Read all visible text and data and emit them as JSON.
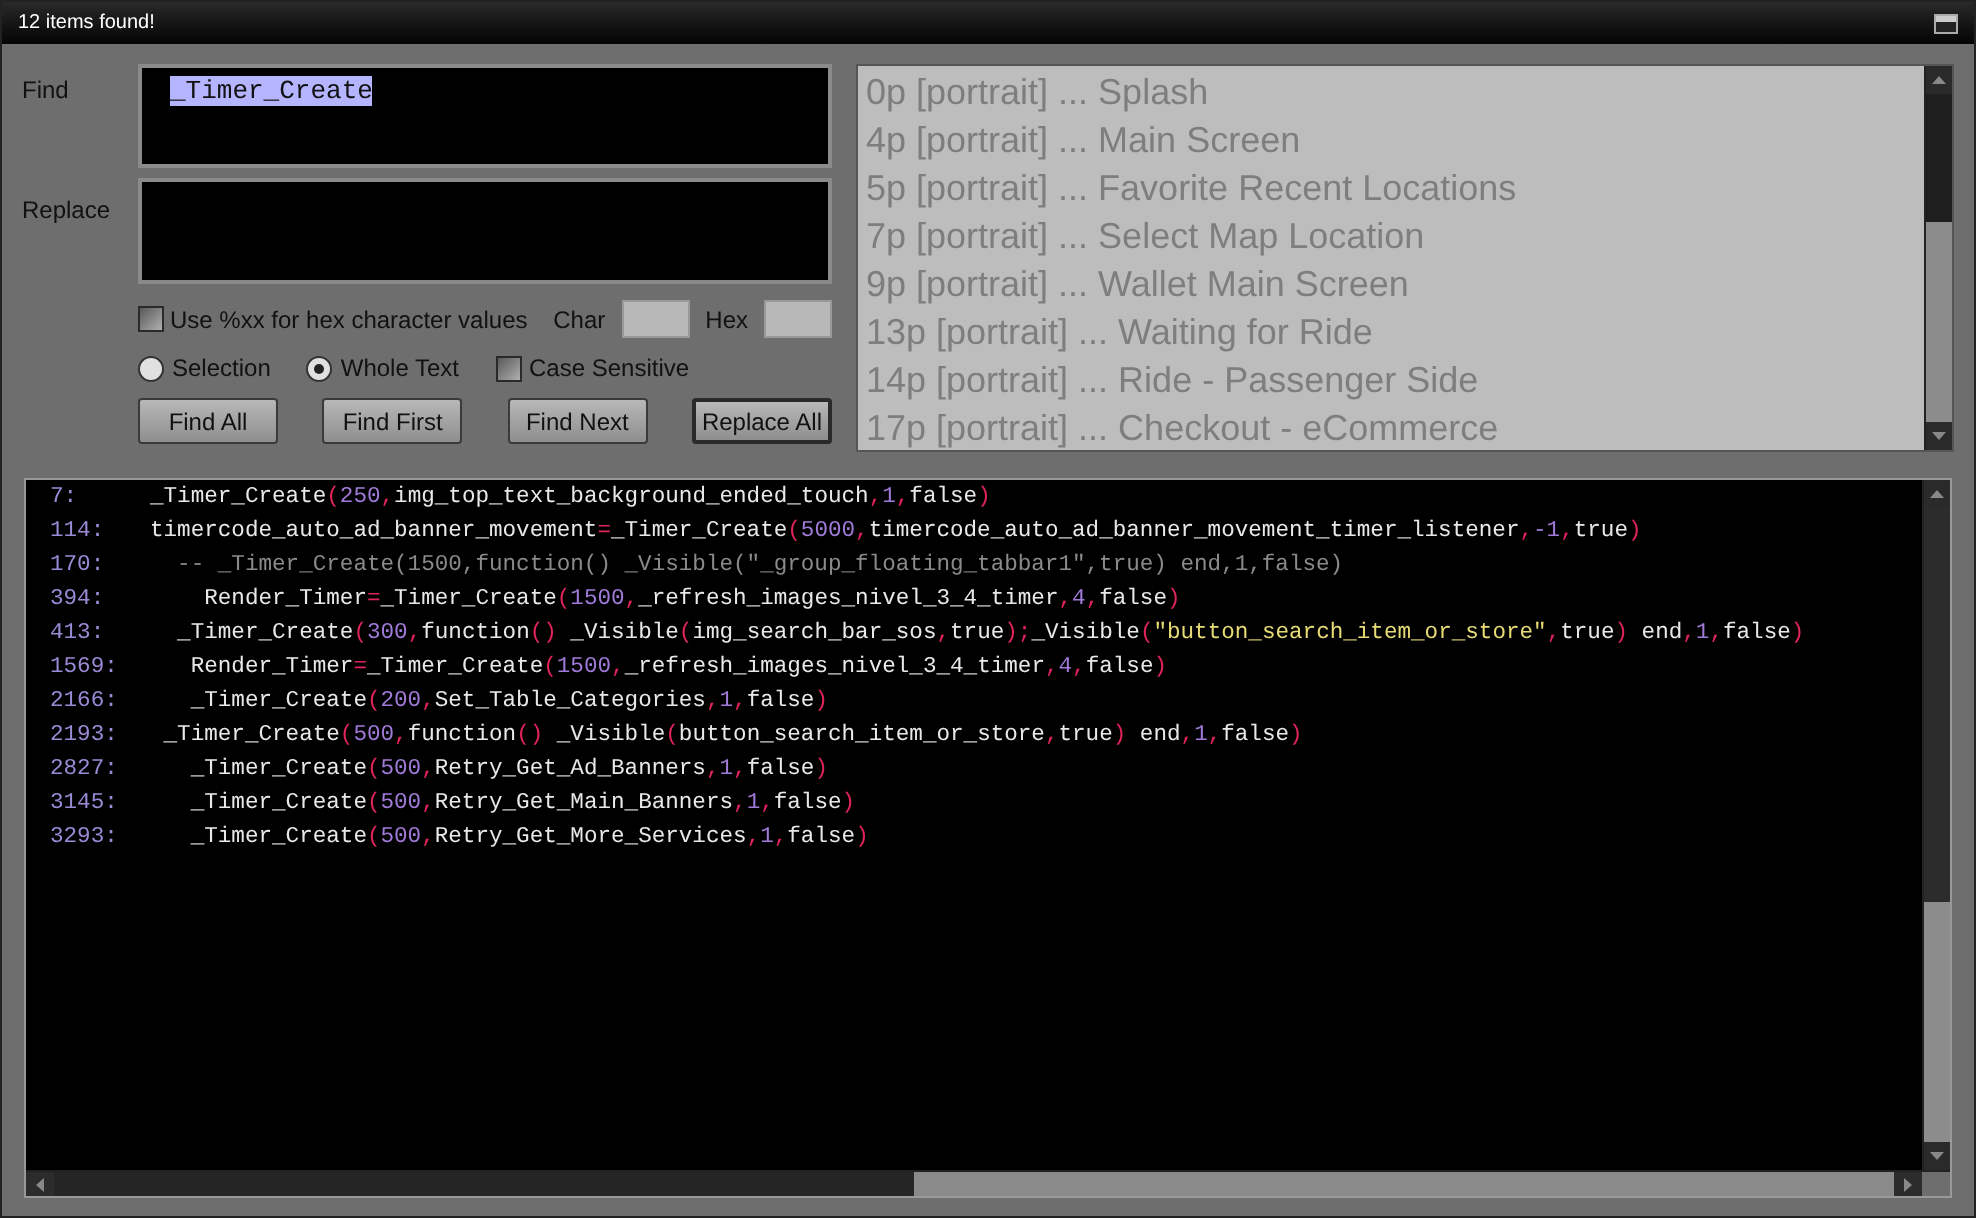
{
  "window": {
    "title": "12 items found!"
  },
  "find": {
    "label": "Find",
    "value": "_Timer_Create",
    "value_selected": true
  },
  "replace": {
    "label": "Replace"
  },
  "hex_option": {
    "label": "Use %xx for hex character values",
    "checked": false
  },
  "char_label": "Char",
  "hex_label": "Hex",
  "scope": [
    {
      "label": "Selection",
      "selected": false
    },
    {
      "label": "Whole Text",
      "selected": true
    }
  ],
  "case_sensitive": {
    "label": "Case Sensitive",
    "checked": false
  },
  "buttons": [
    "Find All",
    "Find First",
    "Find Next",
    "Replace All"
  ],
  "screens": [
    "0p [portrait] ... Splash",
    "4p [portrait] ... Main Screen",
    "5p [portrait] ... Favorite Recent Locations",
    "7p [portrait] ... Select Map Location",
    "9p [portrait] ... Wallet Main Screen",
    "13p [portrait] ... Waiting for Ride",
    "14p [portrait] ... Ride - Passenger Side",
    "17p [portrait] ... Checkout - eCommerce"
  ],
  "results": [
    {
      "line": "7:",
      "code": [
        {
          "kind": "t",
          "text": "_Timer_Create"
        },
        {
          "kind": "p",
          "text": "("
        },
        {
          "kind": "n",
          "text": "250"
        },
        {
          "kind": "p",
          "text": ","
        },
        {
          "kind": "t",
          "text": "img_top_text_background_ended_touch"
        },
        {
          "kind": "p",
          "text": ","
        },
        {
          "kind": "n",
          "text": "1"
        },
        {
          "kind": "p",
          "text": ","
        },
        {
          "kind": "t",
          "text": "false"
        },
        {
          "kind": "p",
          "text": ")"
        }
      ]
    },
    {
      "line": "114:",
      "code": [
        {
          "kind": "t",
          "text": "timercode_auto_ad_banner_movement"
        },
        {
          "kind": "p",
          "text": "="
        },
        {
          "kind": "t",
          "text": "_Timer_Create"
        },
        {
          "kind": "p",
          "text": "("
        },
        {
          "kind": "n",
          "text": "5000"
        },
        {
          "kind": "p",
          "text": ","
        },
        {
          "kind": "t",
          "text": "timercode_auto_ad_banner_movement_timer_listener"
        },
        {
          "kind": "p",
          "text": ","
        },
        {
          "kind": "n",
          "text": "-1"
        },
        {
          "kind": "p",
          "text": ","
        },
        {
          "kind": "t",
          "text": "true"
        },
        {
          "kind": "p",
          "text": ")"
        }
      ]
    },
    {
      "line": "170:",
      "code": [
        {
          "kind": "c",
          "text": "  -- _Timer_Create(1500,function() _Visible(\"_group_floating_tabbar1\",true) end,1,false)"
        }
      ]
    },
    {
      "line": "394:",
      "code": [
        {
          "kind": "t",
          "text": "    Render_Timer"
        },
        {
          "kind": "p",
          "text": "="
        },
        {
          "kind": "t",
          "text": "_Timer_Create"
        },
        {
          "kind": "p",
          "text": "("
        },
        {
          "kind": "n",
          "text": "1500"
        },
        {
          "kind": "p",
          "text": ","
        },
        {
          "kind": "t",
          "text": "_refresh_images_nivel_3_4_timer"
        },
        {
          "kind": "p",
          "text": ","
        },
        {
          "kind": "n",
          "text": "4"
        },
        {
          "kind": "p",
          "text": ","
        },
        {
          "kind": "t",
          "text": "false"
        },
        {
          "kind": "p",
          "text": ")"
        }
      ]
    },
    {
      "line": "413:",
      "code": [
        {
          "kind": "t",
          "text": "  _Timer_Create"
        },
        {
          "kind": "p",
          "text": "("
        },
        {
          "kind": "n",
          "text": "300"
        },
        {
          "kind": "p",
          "text": ","
        },
        {
          "kind": "t",
          "text": "function"
        },
        {
          "kind": "p",
          "text": "()"
        },
        {
          "kind": "t",
          "text": " _Visible"
        },
        {
          "kind": "p",
          "text": "("
        },
        {
          "kind": "t",
          "text": "img_search_bar_sos"
        },
        {
          "kind": "p",
          "text": ","
        },
        {
          "kind": "t",
          "text": "true"
        },
        {
          "kind": "p",
          "text": ");"
        },
        {
          "kind": "t",
          "text": "_Visible"
        },
        {
          "kind": "p",
          "text": "("
        },
        {
          "kind": "s",
          "text": "\"button_search_item_or_store\""
        },
        {
          "kind": "p",
          "text": ","
        },
        {
          "kind": "t",
          "text": "true"
        },
        {
          "kind": "p",
          "text": ")"
        },
        {
          "kind": "t",
          "text": " end"
        },
        {
          "kind": "p",
          "text": ","
        },
        {
          "kind": "n",
          "text": "1"
        },
        {
          "kind": "p",
          "text": ","
        },
        {
          "kind": "t",
          "text": "false"
        },
        {
          "kind": "p",
          "text": ")"
        }
      ]
    },
    {
      "line": "1569:",
      "code": [
        {
          "kind": "t",
          "text": "   Render_Timer"
        },
        {
          "kind": "p",
          "text": "="
        },
        {
          "kind": "t",
          "text": "_Timer_Create"
        },
        {
          "kind": "p",
          "text": "("
        },
        {
          "kind": "n",
          "text": "1500"
        },
        {
          "kind": "p",
          "text": ","
        },
        {
          "kind": "t",
          "text": "_refresh_images_nivel_3_4_timer"
        },
        {
          "kind": "p",
          "text": ","
        },
        {
          "kind": "n",
          "text": "4"
        },
        {
          "kind": "p",
          "text": ","
        },
        {
          "kind": "t",
          "text": "false"
        },
        {
          "kind": "p",
          "text": ")"
        }
      ]
    },
    {
      "line": "2166:",
      "code": [
        {
          "kind": "t",
          "text": "   _Timer_Create"
        },
        {
          "kind": "p",
          "text": "("
        },
        {
          "kind": "n",
          "text": "200"
        },
        {
          "kind": "p",
          "text": ","
        },
        {
          "kind": "t",
          "text": "Set_Table_Categories"
        },
        {
          "kind": "p",
          "text": ","
        },
        {
          "kind": "n",
          "text": "1"
        },
        {
          "kind": "p",
          "text": ","
        },
        {
          "kind": "t",
          "text": "false"
        },
        {
          "kind": "p",
          "text": ")"
        }
      ]
    },
    {
      "line": "2193:",
      "code": [
        {
          "kind": "t",
          "text": " _Timer_Create"
        },
        {
          "kind": "p",
          "text": "("
        },
        {
          "kind": "n",
          "text": "500"
        },
        {
          "kind": "p",
          "text": ","
        },
        {
          "kind": "t",
          "text": "function"
        },
        {
          "kind": "p",
          "text": "()"
        },
        {
          "kind": "t",
          "text": " _Visible"
        },
        {
          "kind": "p",
          "text": "("
        },
        {
          "kind": "t",
          "text": "button_search_item_or_store"
        },
        {
          "kind": "p",
          "text": ","
        },
        {
          "kind": "t",
          "text": "true"
        },
        {
          "kind": "p",
          "text": ")"
        },
        {
          "kind": "t",
          "text": " end"
        },
        {
          "kind": "p",
          "text": ","
        },
        {
          "kind": "n",
          "text": "1"
        },
        {
          "kind": "p",
          "text": ","
        },
        {
          "kind": "t",
          "text": "false"
        },
        {
          "kind": "p",
          "text": ")"
        }
      ]
    },
    {
      "line": "2827:",
      "code": [
        {
          "kind": "t",
          "text": "   _Timer_Create"
        },
        {
          "kind": "p",
          "text": "("
        },
        {
          "kind": "n",
          "text": "500"
        },
        {
          "kind": "p",
          "text": ","
        },
        {
          "kind": "t",
          "text": "Retry_Get_Ad_Banners"
        },
        {
          "kind": "p",
          "text": ","
        },
        {
          "kind": "n",
          "text": "1"
        },
        {
          "kind": "p",
          "text": ","
        },
        {
          "kind": "t",
          "text": "false"
        },
        {
          "kind": "p",
          "text": ")"
        }
      ]
    },
    {
      "line": "3145:",
      "code": [
        {
          "kind": "t",
          "text": "   _Timer_Create"
        },
        {
          "kind": "p",
          "text": "("
        },
        {
          "kind": "n",
          "text": "500"
        },
        {
          "kind": "p",
          "text": ","
        },
        {
          "kind": "t",
          "text": "Retry_Get_Main_Banners"
        },
        {
          "kind": "p",
          "text": ","
        },
        {
          "kind": "n",
          "text": "1"
        },
        {
          "kind": "p",
          "text": ","
        },
        {
          "kind": "t",
          "text": "false"
        },
        {
          "kind": "p",
          "text": ")"
        }
      ]
    },
    {
      "line": "3293:",
      "code": [
        {
          "kind": "t",
          "text": "   _Timer_Create"
        },
        {
          "kind": "p",
          "text": "("
        },
        {
          "kind": "n",
          "text": "500"
        },
        {
          "kind": "p",
          "text": ","
        },
        {
          "kind": "t",
          "text": "Retry_Get_More_Services"
        },
        {
          "kind": "p",
          "text": ","
        },
        {
          "kind": "n",
          "text": "1"
        },
        {
          "kind": "p",
          "text": ","
        },
        {
          "kind": "t",
          "text": "false"
        },
        {
          "kind": "p",
          "text": ")"
        }
      ]
    }
  ]
}
